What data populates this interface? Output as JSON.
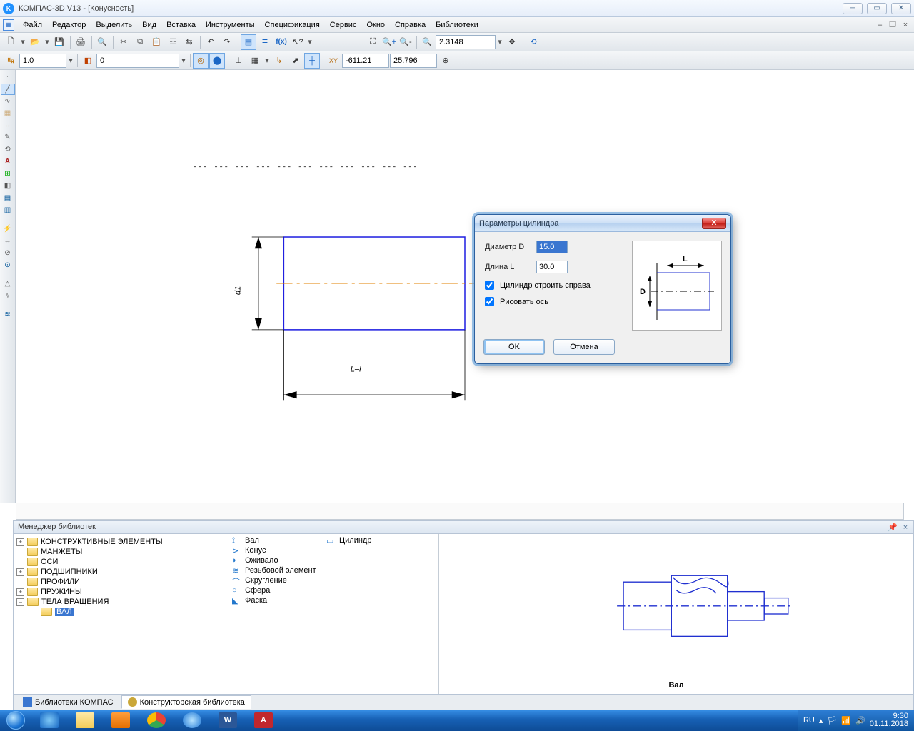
{
  "window": {
    "title": "КОМПАС-3D V13 - [Конусность]"
  },
  "menu": {
    "items": [
      "Файл",
      "Редактор",
      "Выделить",
      "Вид",
      "Вставка",
      "Инструменты",
      "Спецификация",
      "Сервис",
      "Окно",
      "Справка",
      "Библиотеки"
    ]
  },
  "toolbar2": {
    "scale": "1.0",
    "layer": "0",
    "coordX": "-611.21",
    "coordY": "25.796",
    "zoom": "2.3148"
  },
  "dialog": {
    "title": "Параметры цилиндра",
    "diameter_label": "Диаметр D",
    "diameter_value": "15.0",
    "length_label": "Длина L",
    "length_value": "30.0",
    "check1": "Цилиндр строить справа",
    "check2": "Рисовать ось",
    "ok": "OK",
    "cancel": "Отмена",
    "prev_L": "L",
    "prev_D": "D"
  },
  "drawing": {
    "dim_v": "d1",
    "dim_h": "L–l"
  },
  "library": {
    "title": "Менеджер библиотек",
    "tree": [
      {
        "expand": "+",
        "label": "КОНСТРУКТИВНЫЕ ЭЛЕМЕНТЫ"
      },
      {
        "expand": "",
        "label": "МАНЖЕТЫ"
      },
      {
        "expand": "",
        "label": "ОСИ"
      },
      {
        "expand": "+",
        "label": "ПОДШИПНИКИ"
      },
      {
        "expand": "",
        "label": "ПРОФИЛИ"
      },
      {
        "expand": "+",
        "label": "ПРУЖИНЫ"
      },
      {
        "expand": "-",
        "label": "ТЕЛА ВРАЩЕНИЯ"
      },
      {
        "expand": "",
        "label": "ВАЛ",
        "indent": true,
        "selected": true
      }
    ],
    "list1": [
      "Вал",
      "Конус",
      "Оживало",
      "Резьбовой элемент",
      "Скругление",
      "Сфера",
      "Фаска"
    ],
    "list2": [
      "Цилиндр"
    ],
    "preview_label": "Вал",
    "tabs": [
      "Библиотеки КОМПАС",
      "Конструкторская библиотека"
    ]
  },
  "taskbar": {
    "lang": "RU",
    "time": "9:30",
    "date": "01.11.2018"
  }
}
